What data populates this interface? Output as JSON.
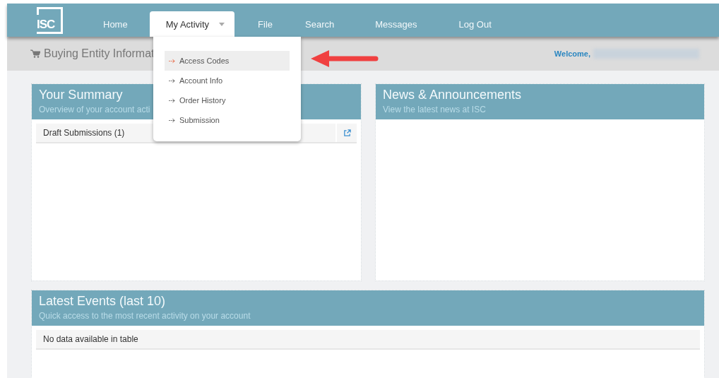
{
  "logo": {
    "text": "ISC"
  },
  "nav": {
    "items": [
      {
        "label": "Home",
        "selected": false,
        "caret": false
      },
      {
        "label": "My Activity",
        "selected": true,
        "caret": true
      },
      {
        "label": "File",
        "selected": false,
        "caret": false
      },
      {
        "label": "Search",
        "selected": false,
        "caret": false
      },
      {
        "label": "Messages",
        "selected": false,
        "caret": false
      },
      {
        "label": "Log Out",
        "selected": false,
        "caret": false
      }
    ]
  },
  "menu": {
    "items": [
      {
        "label": "Access Codes",
        "selected": true
      },
      {
        "label": "Account Info",
        "selected": false
      },
      {
        "label": "Order History",
        "selected": false
      },
      {
        "label": "Submission",
        "selected": false
      }
    ]
  },
  "header_bar": {
    "title": "Buying Entity Informat",
    "welcome": "Welcome,"
  },
  "panels": [
    {
      "title": "Your Summary",
      "subtitle": "Overview of your account acti",
      "rows": [
        {
          "text": "Draft Submissions (1)",
          "link": true
        }
      ]
    },
    {
      "title": "News & Announcements",
      "subtitle": "View the latest news at ISC"
    }
  ],
  "events": {
    "title": "Latest Events (last 10)",
    "subtitle": "Quick access to the most recent activity on your account",
    "rows": [
      {
        "text": "No data available in table",
        "link": false
      }
    ]
  }
}
